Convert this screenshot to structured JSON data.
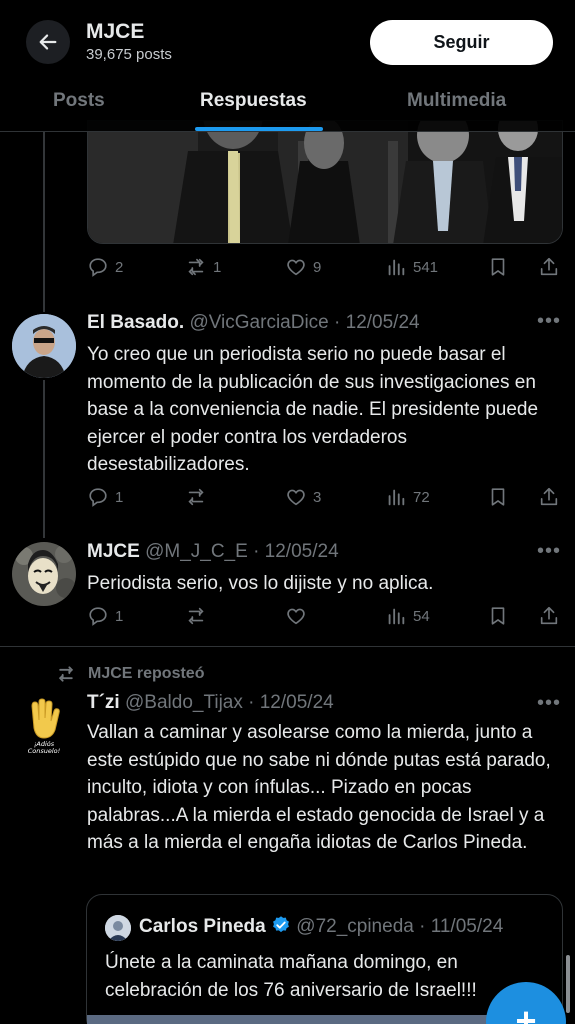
{
  "header": {
    "name": "MJCE",
    "posts_count": "39,675 posts",
    "follow_label": "Seguir"
  },
  "tabs": [
    "Posts",
    "Respuestas",
    "Multimedia"
  ],
  "active_tab": "Respuestas",
  "first_post_actions": {
    "replies": "2",
    "reposts": "1",
    "likes": "9",
    "views": "541"
  },
  "posts": [
    {
      "name": "El Basado.",
      "handle_date": "@VicGarciaDice · 12/05/24",
      "text": "Yo creo que un periodista serio no puede basar el momento de la publicación de sus investigaciones en base a la conveniencia de nadie. El presidente puede ejercer el poder contra los verdaderos desestabilizadores.",
      "replies": "1",
      "reposts": "",
      "likes": "3",
      "views": "72"
    },
    {
      "name": "MJCE",
      "handle_date": "@M_J_C_E · 12/05/24",
      "text": "Periodista serio, vos lo dijiste y no aplica.",
      "replies": "1",
      "reposts": "",
      "likes": "",
      "views": "54"
    }
  ],
  "repost_label": "MJCE reposteó",
  "reposted_post": {
    "name": "T´zi",
    "handle_date": "@Baldo_Tijax · 12/05/24",
    "avatar_text": "¡Adiós Consuelo!",
    "text": "Vallan a caminar y asolearse como la mierda, junto a este estúpido que no sabe ni dónde putas está parado, inculto, idiota y con ínfulas... Pizado en pocas palabras...A la mierda el estado genocida de Israel y a más a la mierda el engaña idiotas de Carlos Pineda."
  },
  "quote": {
    "name": "Carlos Pineda",
    "handle_date": "@72_cpineda · 11/05/24",
    "text": "Únete a la caminata mañana domingo, en celebración de los 76 aniversario de Israel!!!"
  },
  "fab_label": "+",
  "colors": {
    "accent": "#1d9bf0",
    "verified": "#1d9bf0",
    "muted": "#71767b",
    "text": "#e7e9ea",
    "background": "#000000"
  },
  "icons": [
    "back-arrow-icon",
    "reply-icon",
    "repost-icon",
    "like-icon",
    "views-icon",
    "bookmark-icon",
    "share-icon",
    "more-icon",
    "verified-badge-icon",
    "compose-icon"
  ]
}
